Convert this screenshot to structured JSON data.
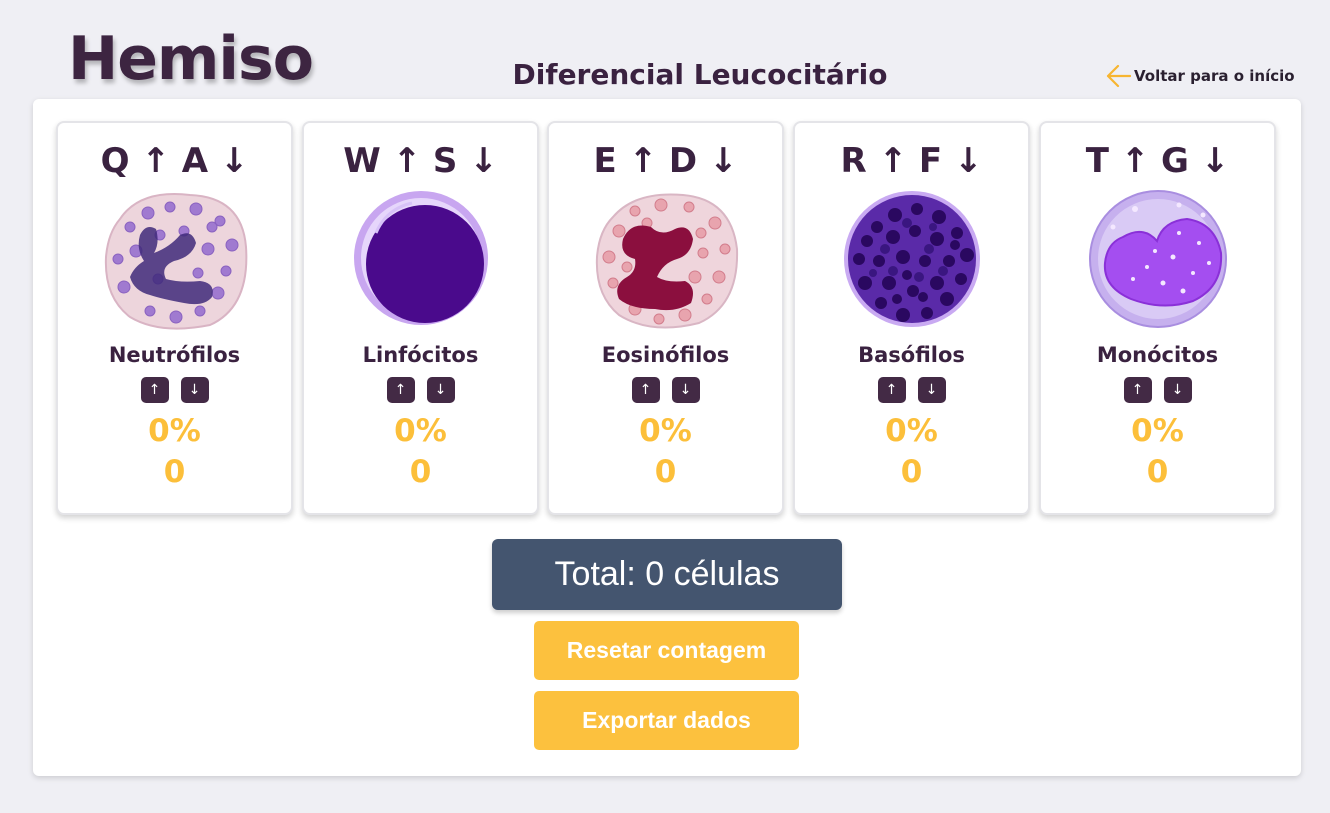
{
  "app": {
    "logo": "Hemiso",
    "title": "Diferencial Leucocitário",
    "back_label": "Voltar para o início"
  },
  "cells": [
    {
      "keys": "Q ↑ A ↓",
      "name": "Neutrófilos",
      "up": "↑",
      "down": "↓",
      "percent": "0%",
      "count": "0"
    },
    {
      "keys": "W ↑ S ↓",
      "name": "Linfócitos",
      "up": "↑",
      "down": "↓",
      "percent": "0%",
      "count": "0"
    },
    {
      "keys": "E ↑ D ↓",
      "name": "Eosinófilos",
      "up": "↑",
      "down": "↓",
      "percent": "0%",
      "count": "0"
    },
    {
      "keys": "R ↑ F ↓",
      "name": "Basófilos",
      "up": "↑",
      "down": "↓",
      "percent": "0%",
      "count": "0"
    },
    {
      "keys": "T ↑ G ↓",
      "name": "Monócitos",
      "up": "↑",
      "down": "↓",
      "percent": "0%",
      "count": "0"
    }
  ],
  "total_label": "Total: 0 células",
  "actions": {
    "reset": "Resetar contagem",
    "export": "Exportar dados"
  },
  "colors": {
    "accent": "#fcbf3a",
    "dark": "#432a45",
    "total_bg": "#44556f"
  }
}
